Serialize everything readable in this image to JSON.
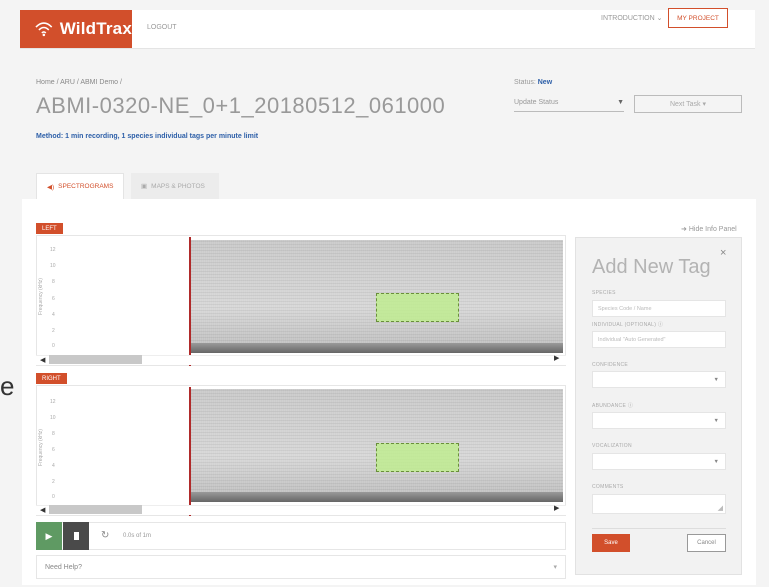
{
  "nav": {
    "brand": "WildTrax",
    "logout": "LOGOUT",
    "introduction": "INTRODUCTION",
    "my_project": "MY PROJECT"
  },
  "header": {
    "breadcrumb": "Home / ARU / ABMI Demo /",
    "title": "ABMI-0320-NE_0+1_20180512_061000",
    "method": "Method: 1 min recording, 1 species individual tags per minute limit",
    "status_label": "Status:",
    "status_value": "New",
    "update_status": "Update Status",
    "next_task": "Next Task"
  },
  "tabs": {
    "spectrogram": "SPECTROGRAMS",
    "maps": "MAPS & PHOTOS"
  },
  "info_panel": {
    "hide": "Hide Info Panel"
  },
  "channels": {
    "left": "LEFT",
    "right": "RIGHT",
    "ylabel": "Frequency (kHz)",
    "ticks": [
      "12",
      "10",
      "8",
      "6",
      "4",
      "2",
      "0"
    ]
  },
  "player": {
    "time": "0.0s of 1m"
  },
  "help": {
    "label": "Need Help?"
  },
  "tag_form": {
    "title": "Add New Tag",
    "species_label": "SPECIES",
    "species_placeholder": "Species Code / Name",
    "individual_label": "INDIVIDUAL (OPTIONAL)",
    "individual_placeholder": "Individual \"Auto Generated\"",
    "confidence_label": "CONFIDENCE",
    "abundance_label": "ABUNDANCE",
    "vocalization_label": "VOCALIZATION",
    "comments_label": "COMMENTS",
    "save": "Save",
    "cancel": "Cancel"
  },
  "colors": {
    "brand": "#d24f2b",
    "play": "#5f9a63",
    "tag_fill": "#bfee8c"
  },
  "page_edge_text": "e"
}
